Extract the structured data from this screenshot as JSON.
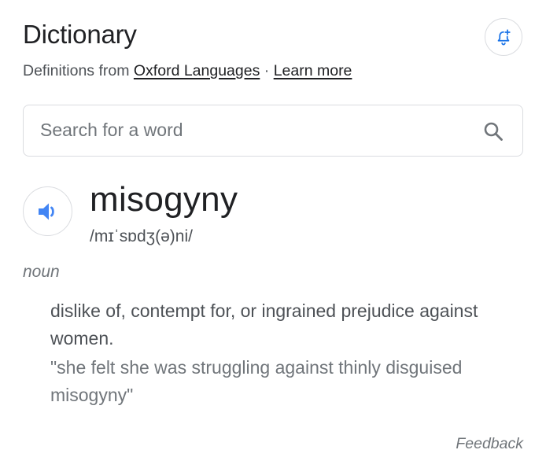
{
  "header": {
    "title": "Dictionary",
    "source_prefix": "Definitions from",
    "source_link": "Oxford Languages",
    "separator": "·",
    "learn_more": "Learn more",
    "alert_icon": "bell-plus-icon"
  },
  "search": {
    "placeholder": "Search for a word",
    "value": "",
    "icon": "search-icon"
  },
  "entry": {
    "speaker_icon": "speaker-icon",
    "word": "misogyny",
    "phonetic": "/mɪˈsɒdʒ(ə)ni/",
    "part_of_speech": "noun",
    "definition": "dislike of, contempt for, or ingrained prejudice against women.",
    "example": "\"she felt she was struggling against thinly disguised misogyny\""
  },
  "footer": {
    "feedback": "Feedback"
  },
  "colors": {
    "accent_blue": "#4285f4",
    "title_text": "#202124",
    "secondary_text": "#4d5156",
    "muted_text": "#70757a",
    "border": "#dadce0"
  }
}
